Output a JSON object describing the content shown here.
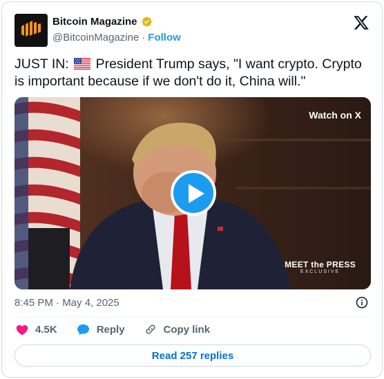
{
  "account": {
    "display_name": "Bitcoin Magazine",
    "handle": "@BitcoinMagazine",
    "separator": "·",
    "follow_label": "Follow"
  },
  "tweet": {
    "text_prefix": "JUST IN:",
    "text_body": "President Trump says, \"I want crypto. Crypto is important because if we don't do it, China will.\"",
    "flag_icon": "us-flag-icon"
  },
  "media": {
    "watch_label": "Watch on X",
    "network_logo_title": "MEET the PRESS",
    "network_logo_sub": "EXCLUSIVE"
  },
  "meta": {
    "timestamp": "8:45 PM · May 4, 2025"
  },
  "actions": {
    "like_count": "4.5K",
    "reply_label": "Reply",
    "copy_link_label": "Copy link"
  },
  "footer": {
    "read_replies_label": "Read 257 replies"
  },
  "colors": {
    "accent": "#1d9bf0",
    "verified_gold": "#e2b719",
    "like_red": "#f91880",
    "text_secondary": "#536471"
  }
}
